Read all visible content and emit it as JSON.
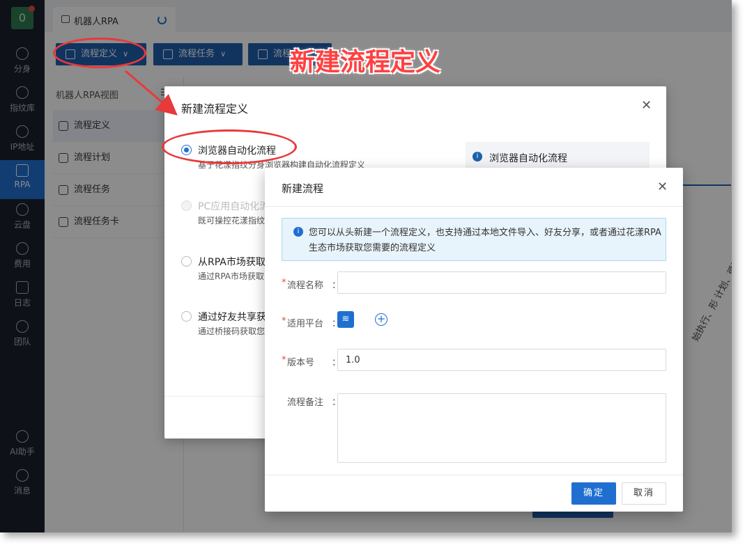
{
  "sidebar": {
    "logo_text": "0",
    "items": [
      {
        "label": "分身",
        "icon": "chrome-icon"
      },
      {
        "label": "指纹库",
        "icon": "fingerprint-icon"
      },
      {
        "label": "IP地址",
        "icon": "ip-icon"
      },
      {
        "label": "RPA",
        "icon": "robot-icon",
        "active": true
      },
      {
        "label": "云盘",
        "icon": "cloud-drive-icon"
      },
      {
        "label": "费用",
        "icon": "yen-icon"
      },
      {
        "label": "日志",
        "icon": "log-icon"
      },
      {
        "label": "团队",
        "icon": "team-icon"
      }
    ],
    "bottom_items": [
      {
        "label": "AI助手",
        "icon": "ai-icon"
      },
      {
        "label": "消息",
        "icon": "bell-icon"
      }
    ]
  },
  "tab": {
    "label": "机器人RPA"
  },
  "toolbar": {
    "buttons": [
      {
        "label": "流程定义",
        "chevron": "∨"
      },
      {
        "label": "流程任务",
        "chevron": "∨"
      },
      {
        "label": "流程"
      }
    ]
  },
  "subnav": {
    "title": "机器人RPA视图",
    "collapse": "☰",
    "items": [
      {
        "label": "流程定义",
        "active": true
      },
      {
        "label": "流程计划"
      },
      {
        "label": "流程任务"
      },
      {
        "label": "流程任务卡"
      }
    ]
  },
  "background": {
    "rotated_text": "始执行、形 计划、循环"
  },
  "dialog_define": {
    "title": "新建流程定义",
    "close": "✕",
    "options": [
      {
        "label": "浏览器自动化流程",
        "desc": "基于花漾指纹分身浏览器构建自动化流程定义",
        "checked": true,
        "disabled": false
      },
      {
        "label": "PC应用自动化流",
        "desc": "既可操控花漾指纹",
        "checked": false,
        "disabled": true
      },
      {
        "label": "从RPA市场获取",
        "desc": "通过RPA市场获取",
        "checked": false,
        "disabled": false
      },
      {
        "label": "通过好友共享获",
        "desc": "通过桥接码获取您",
        "checked": false,
        "disabled": false
      }
    ],
    "info_title": "浏览器自动化流程",
    "info_icon": "i"
  },
  "dialog_new": {
    "title": "新建流程",
    "close": "✕",
    "alert_icon": "i",
    "alert_text": "您可以从头新建一个流程定义，也支持通过本地文件导入、好友分享，或者通过花漾RPA生态市场获取您需要的流程定义",
    "fields": {
      "name": {
        "label": "流程名称",
        "required": true,
        "value": "",
        "placeholder": ""
      },
      "platform": {
        "label": "适用平台",
        "required": true,
        "layers_icon": "≋",
        "add_icon": "+"
      },
      "version": {
        "label": "版本号",
        "required": true,
        "value": "1.0"
      },
      "remark": {
        "label": "流程备注",
        "required": false,
        "value": ""
      }
    },
    "required_mark": "*",
    "colon": "：",
    "ok_label": "确定",
    "cancel_label": "取消"
  },
  "annotation": {
    "title": "新建流程定义",
    "color": "#e8393b"
  }
}
